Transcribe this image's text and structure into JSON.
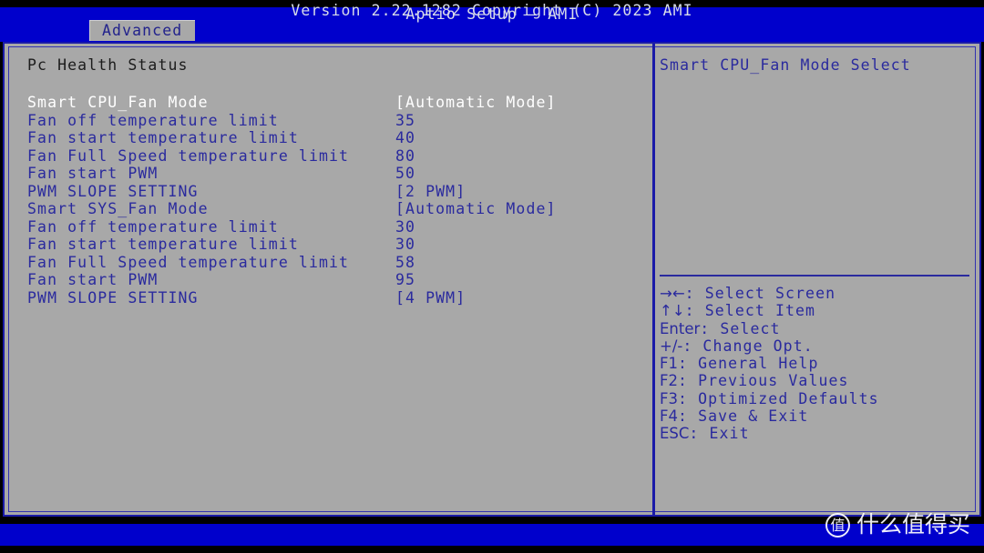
{
  "window": {
    "app_title": "Aptio Setup – AMI",
    "status_bar": "Version 2.22.1282 Copyright (C) 2023 AMI"
  },
  "tabs": [
    {
      "label": "Advanced",
      "active": true
    }
  ],
  "main": {
    "section_heading": "Pc Health Status",
    "rows": [
      {
        "label": "Smart CPU_Fan Mode",
        "value": "[Automatic Mode]",
        "selected": true
      },
      {
        "label": "Fan off temperature limit",
        "value": "35",
        "selected": false
      },
      {
        "label": "Fan start temperature limit",
        "value": "40",
        "selected": false
      },
      {
        "label": "Fan Full Speed temperature limit",
        "value": "80",
        "selected": false
      },
      {
        "label": "Fan start PWM",
        "value": "50",
        "selected": false
      },
      {
        "label": "PWM SLOPE SETTING",
        "value": "[2 PWM]",
        "selected": false
      },
      {
        "label": "Smart SYS_Fan Mode",
        "value": "[Automatic Mode]",
        "selected": false
      },
      {
        "label": "Fan off temperature limit",
        "value": "30",
        "selected": false
      },
      {
        "label": "Fan start temperature limit",
        "value": "30",
        "selected": false
      },
      {
        "label": "Fan Full Speed temperature limit",
        "value": "58",
        "selected": false
      },
      {
        "label": "Fan start PWM",
        "value": "95",
        "selected": false
      },
      {
        "label": "PWM SLOPE SETTING",
        "value": "[4 PWM]",
        "selected": false
      }
    ]
  },
  "help": {
    "description": "Smart CPU_Fan Mode Select",
    "legend": [
      {
        "keys": "→←",
        "text": ": Select Screen"
      },
      {
        "keys": "↑↓",
        "text": ": Select Item"
      },
      {
        "keys": "Enter",
        "text": ": Select"
      },
      {
        "keys": "+/-",
        "text": ": Change Opt."
      },
      {
        "keys": "F1",
        "text": ": General Help"
      },
      {
        "keys": "F2",
        "text": ": Previous Values"
      },
      {
        "keys": "F3",
        "text": ": Optimized Defaults"
      },
      {
        "keys": "F4",
        "text": ": Save & Exit"
      },
      {
        "keys": "ESC",
        "text": ": Exit"
      }
    ]
  },
  "watermark": {
    "badge": "值",
    "text": "什么值得买"
  },
  "colors": {
    "header_blue": "#0000cc",
    "panel_gray": "#a8a8a8",
    "item_blue": "#2a2a9e",
    "selected_white": "#ffffff",
    "heading_black": "#1c1c1c"
  }
}
